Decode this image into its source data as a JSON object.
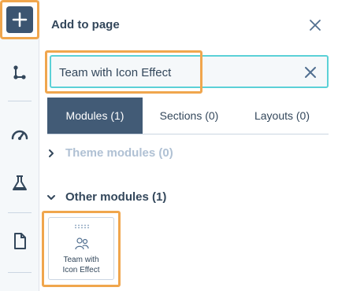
{
  "panel": {
    "title": "Add to page",
    "search": {
      "value": "Team with Icon Effect"
    },
    "tabs": [
      {
        "label": "Modules (1)",
        "active": true
      },
      {
        "label": "Sections (0)",
        "active": false
      },
      {
        "label": "Layouts (0)",
        "active": false
      }
    ],
    "groups": [
      {
        "label": "Theme modules (0)",
        "expanded": false
      },
      {
        "label": "Other modules (1)",
        "expanded": true
      }
    ],
    "modules": [
      {
        "label_line1": "Team with",
        "label_line2": "Icon Effect",
        "icon": "people-icon"
      }
    ]
  },
  "rail": {
    "items": [
      "add-icon",
      "tree-icon",
      "gauge-icon",
      "flask-icon",
      "page-icon"
    ]
  },
  "colors": {
    "highlight": "#f0a64d",
    "rail_active": "#3c5571",
    "tab_active": "#425b76",
    "search_border": "#5bd1d7",
    "text": "#33475b",
    "muted": "#b0c1d4"
  }
}
